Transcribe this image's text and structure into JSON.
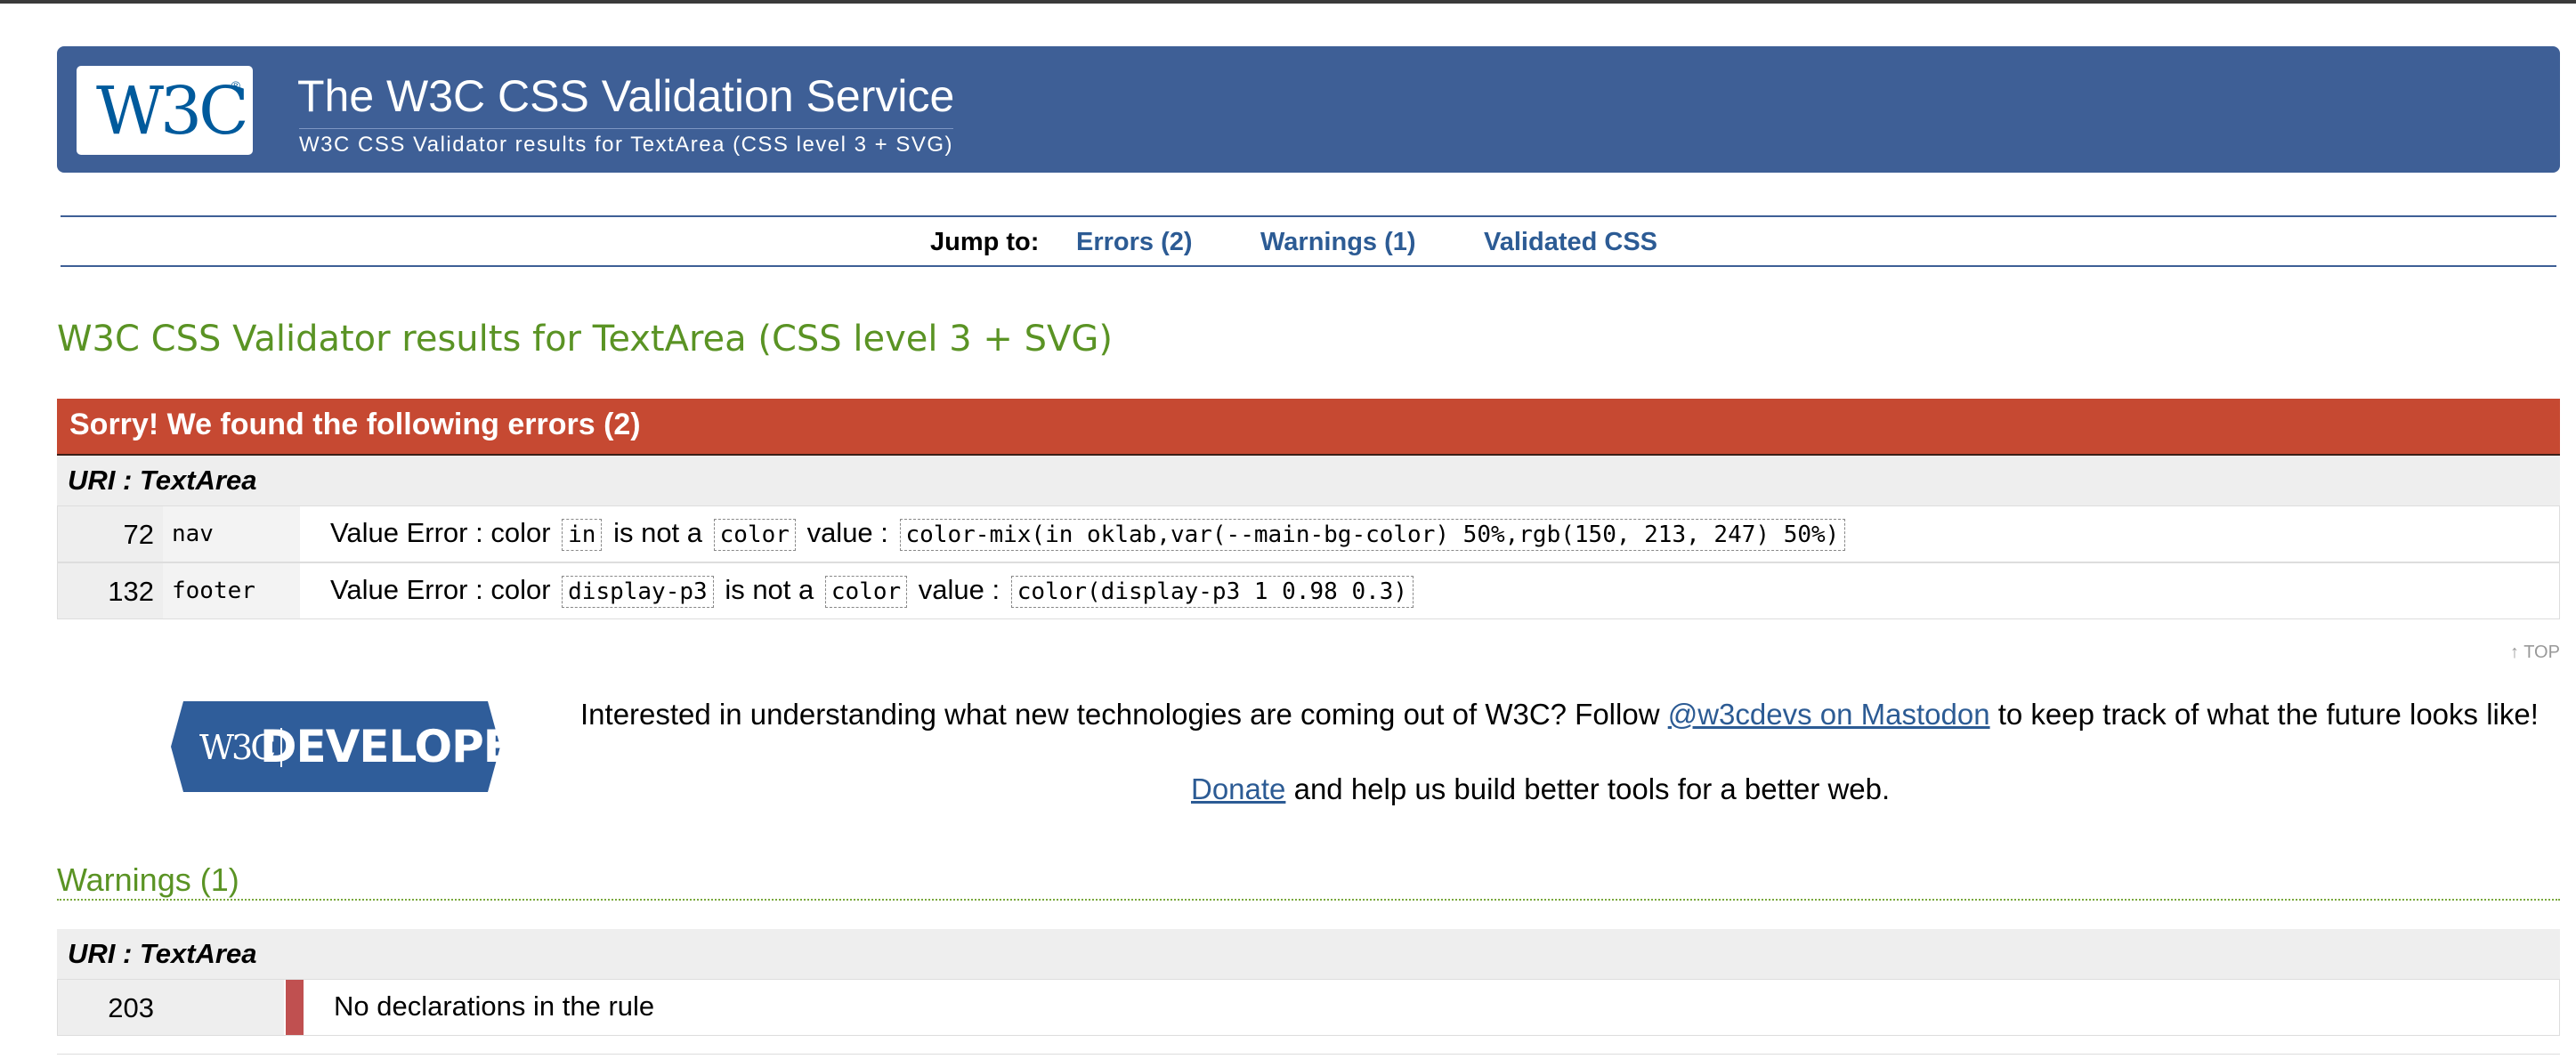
{
  "header": {
    "logo_text": "W3C",
    "logo_reg": "®",
    "title": "The W3C CSS Validation Service",
    "subtitle": "W3C CSS Validator results for TextArea (CSS level 3 + SVG)"
  },
  "jump": {
    "label": "Jump to:",
    "links": [
      "Errors (2)",
      "Warnings (1)",
      "Validated CSS"
    ]
  },
  "results_heading": "W3C CSS Validator results for TextArea (CSS level 3 + SVG)",
  "errors": {
    "header": "Sorry! We found the following errors (2)",
    "uri": "URI : TextArea",
    "rows": [
      {
        "line": "72",
        "context": "nav",
        "pre": "Value Error : color",
        "val1": "in",
        "mid": "is not a",
        "val2": "color",
        "post": "value :",
        "val3": "color-mix(in oklab,var(--main-bg-color) 50%,rgb(150, 213, 247) 50%)"
      },
      {
        "line": "132",
        "context": "footer",
        "pre": "Value Error : color",
        "val1": "display-p3",
        "mid": "is not a",
        "val2": "color",
        "post": "value :",
        "val3": "color(display-p3 1 0.98 0.3)"
      }
    ]
  },
  "top_link": "↑ TOP",
  "developers": {
    "badge_w3c": "W3C",
    "badge_text": "DEVELOPERS",
    "promo_before": "Interested in understanding what new technologies are coming out of W3C? Follow",
    "promo_link": "@w3cdevs on Mastodon",
    "promo_after": "to keep track of what the future looks like!",
    "donate_link": "Donate",
    "donate_after": "and help us build better tools for a better web."
  },
  "warnings": {
    "heading": "Warnings (1)",
    "uri": "URI : TextArea",
    "rows": [
      {
        "line": "203",
        "context": "",
        "message": "No declarations in the rule"
      }
    ]
  },
  "colors": {
    "banner": "#3e5f96",
    "error_header": "#c64932",
    "heading_green": "#5a9324",
    "link": "#2c5b94"
  }
}
